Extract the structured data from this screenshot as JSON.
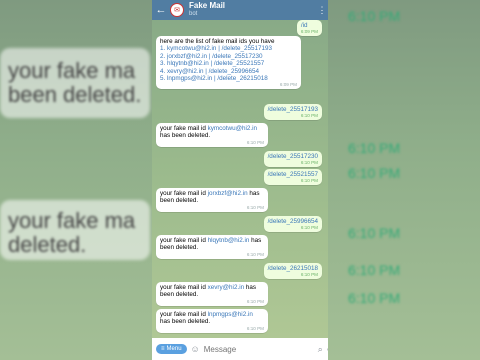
{
  "header": {
    "back_icon": "arrow-left-icon",
    "title": "Fake Mail",
    "subtitle": "bot",
    "menu_icon": "more-vertical-icon"
  },
  "messages": [
    {
      "dir": "out",
      "text": "/id",
      "time": "6:09 PM"
    },
    {
      "dir": "in",
      "lines": [
        "here are the list of fake mail ids you have",
        "1. kymcotwu@hi2.in | /delete_25517193",
        "2. jorxbzf@hi2.in | /delete_25517230",
        "3. hlqytnb@hi2.in | /delete_25521557",
        "4. xevry@hi2.in | /delete_25996654",
        "5. lnpmgps@hi2.in | /delete_26215018"
      ],
      "time": "6:09 PM"
    },
    {
      "dir": "out",
      "text": "/delete_25517193",
      "time": "6:10 PM"
    },
    {
      "dir": "in",
      "prefix": "your fake mail id ",
      "email": "kymcotwu@hi2.in",
      "suffix": " has been deleted.",
      "time": "6:10 PM"
    },
    {
      "dir": "out",
      "text": "/delete_25517230",
      "time": "6:10 PM"
    },
    {
      "dir": "out",
      "text": "/delete_25521557",
      "time": "6:10 PM"
    },
    {
      "dir": "in",
      "prefix": "your fake mail id ",
      "email": "jorxbzf@hi2.in",
      "suffix": " has been deleted.",
      "time": "6:10 PM"
    },
    {
      "dir": "out",
      "text": "/delete_25996654",
      "time": "6:10 PM"
    },
    {
      "dir": "in",
      "prefix": "your fake mail id ",
      "email": "hlqytnb@hi2.in",
      "suffix": " has been deleted.",
      "time": "6:10 PM"
    },
    {
      "dir": "out",
      "text": "/delete_26215018",
      "time": "6:10 PM"
    },
    {
      "dir": "in",
      "prefix": "your fake mail id ",
      "email": "xevry@hi2.in",
      "suffix": " has been deleted.",
      "time": "6:10 PM"
    },
    {
      "dir": "in",
      "prefix": "your fake mail id ",
      "email": "lnpmgps@hi2.in",
      "suffix": " has been deleted.",
      "time": "6:10 PM"
    }
  ],
  "composer": {
    "menu_label": "Menu",
    "placeholder": "Message",
    "emoji_icon": "smile-icon",
    "attach_icon": "paperclip-icon",
    "mic_icon": "microphone-icon"
  },
  "background_text": {
    "left_lines": [
      "your fake ma",
      "been deleted.",
      "your fake ma",
      "deleted."
    ],
    "right_times": [
      "6:10 PM",
      "6:10 PM",
      "6:10 PM",
      "6:10 PM",
      "6:10 PM",
      "6:10 PM"
    ]
  },
  "colors": {
    "header": "#517da2",
    "outgoing_bubble": "#effdde",
    "incoming_bubble": "#ffffff",
    "link": "#3a77b8",
    "menu_button": "#5aa0e0"
  }
}
